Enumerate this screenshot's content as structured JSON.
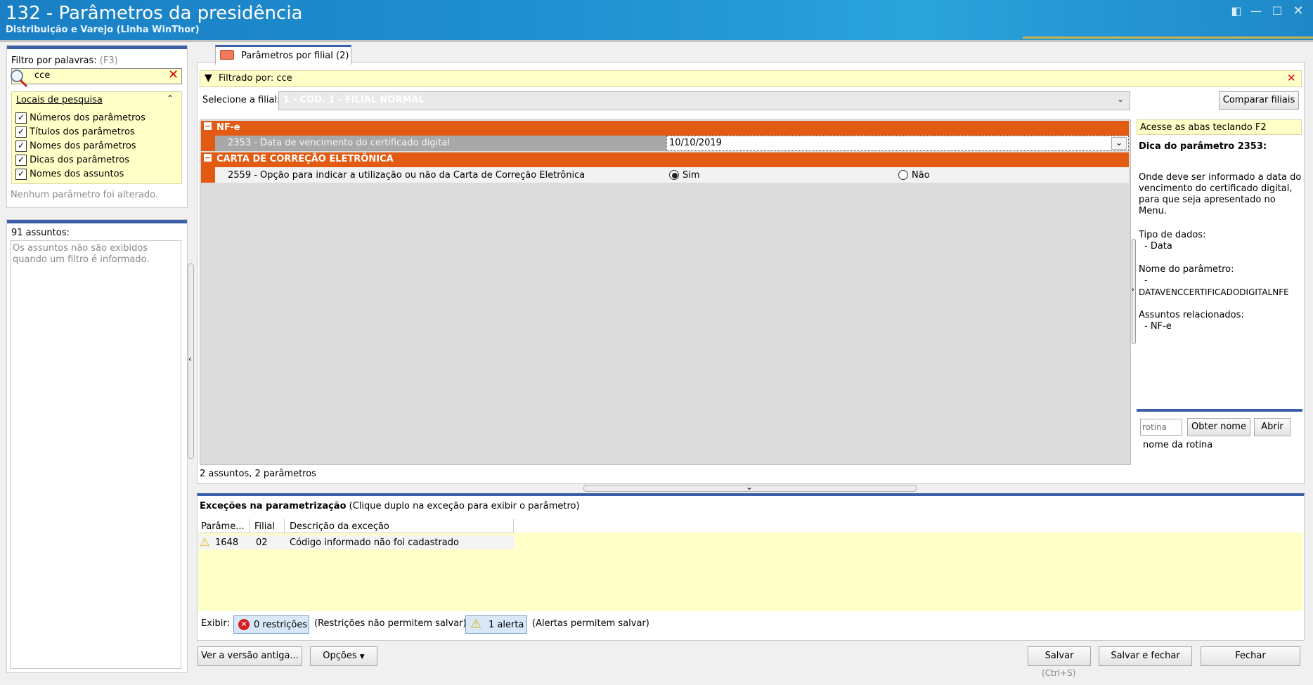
{
  "window": {
    "title": "132 - Parâmetros da presidência",
    "subtitle": "Distribuição e Varejo (Linha WinThor)"
  },
  "left": {
    "filter_label": "Filtro por palavras:",
    "filter_shortcut": "(F3)",
    "search_value": "cce",
    "locals_title": "Locais de pesquisa",
    "locals": [
      {
        "label": "Números dos parâmetros",
        "checked": true
      },
      {
        "label": "Títulos dos parâmetros",
        "checked": true
      },
      {
        "label": "Nomes dos parâmetros",
        "checked": true
      },
      {
        "label": "Dicas dos parâmetros",
        "checked": true
      },
      {
        "label": "Nomes dos assuntos",
        "checked": true
      }
    ],
    "no_change": "Nenhum parâmetro foi alterado.",
    "subjects_count": "91 assuntos:",
    "subjects_note": "Os assuntos não são exibidos quando um filtro é informado."
  },
  "tab": {
    "label": "Parâmetros por filial",
    "count": "(2)"
  },
  "filter_bar": {
    "text": "Filtrado por: cce"
  },
  "branch": {
    "label": "Selecione a filial:",
    "value": "1 - COD. 1 - FILIAL NORMAL",
    "compare_button": "Comparar filiais"
  },
  "groups": [
    {
      "title": "NF-e",
      "param_label": "2353 - Data de vencimento do certificado digital",
      "value": "10/10/2019"
    },
    {
      "title": "CARTA DE CORREÇÃO ELETRÔNICA",
      "param_label": "2559 - Opção para indicar a utilização ou não da Carta de Correção Eletrônica",
      "opt_yes": "Sim",
      "opt_no": "Não",
      "selected": "Sim"
    }
  ],
  "grid_footer": "2 assuntos, 2 parâmetros",
  "hint": {
    "shortcut": "Acesse as abas teclando F2",
    "title": "Dica do parâmetro 2353:",
    "body": "Onde deve ser informado a data do vencimento do certificado digital, para que seja apresentado no Menu.",
    "data_type_label": "Tipo de dados:",
    "data_type_value": "- Data",
    "param_name_label": "Nome do parâmetro:",
    "param_name_dash": "-",
    "param_name_value": "DATAVENCCERTIFICADODIGITALNFE",
    "related_label": "Assuntos relacionados:",
    "related_value": "- NF-e"
  },
  "routine": {
    "placeholder": "rotina",
    "get_name_button": "Obter nome",
    "open_button": "Abrir",
    "name_label": "nome da rotina"
  },
  "exceptions": {
    "title": "Exceções na parametrização",
    "note": "(Clique duplo na exceção para exibir o parâmetro)",
    "columns": [
      "Parâme...",
      "Filial",
      "Descrição da exceção"
    ],
    "rows": [
      {
        "param": "1648",
        "branch": "02",
        "desc": "Código informado não foi cadastrado"
      }
    ],
    "show_label": "Exibir:",
    "restrictions_button": "0 restrições",
    "restrictions_note": "(Restrições não permitem salvar)",
    "alerts_button": "1 alerta",
    "alerts_note": "(Alertas permitem salvar)"
  },
  "footer": {
    "old_version_button": "Ver a versão antiga...",
    "options_button": "Opções",
    "save_button": "Salvar",
    "save_shortcut": "(Ctrl+S)",
    "save_close_button": "Salvar e fechar",
    "close_button": "Fechar"
  },
  "colors": {
    "title_bar": "#1f8fd0",
    "group_header": "#e35b12",
    "panel_accent": "#3a5fa8",
    "highlight_yellow": "#ffffc8"
  }
}
